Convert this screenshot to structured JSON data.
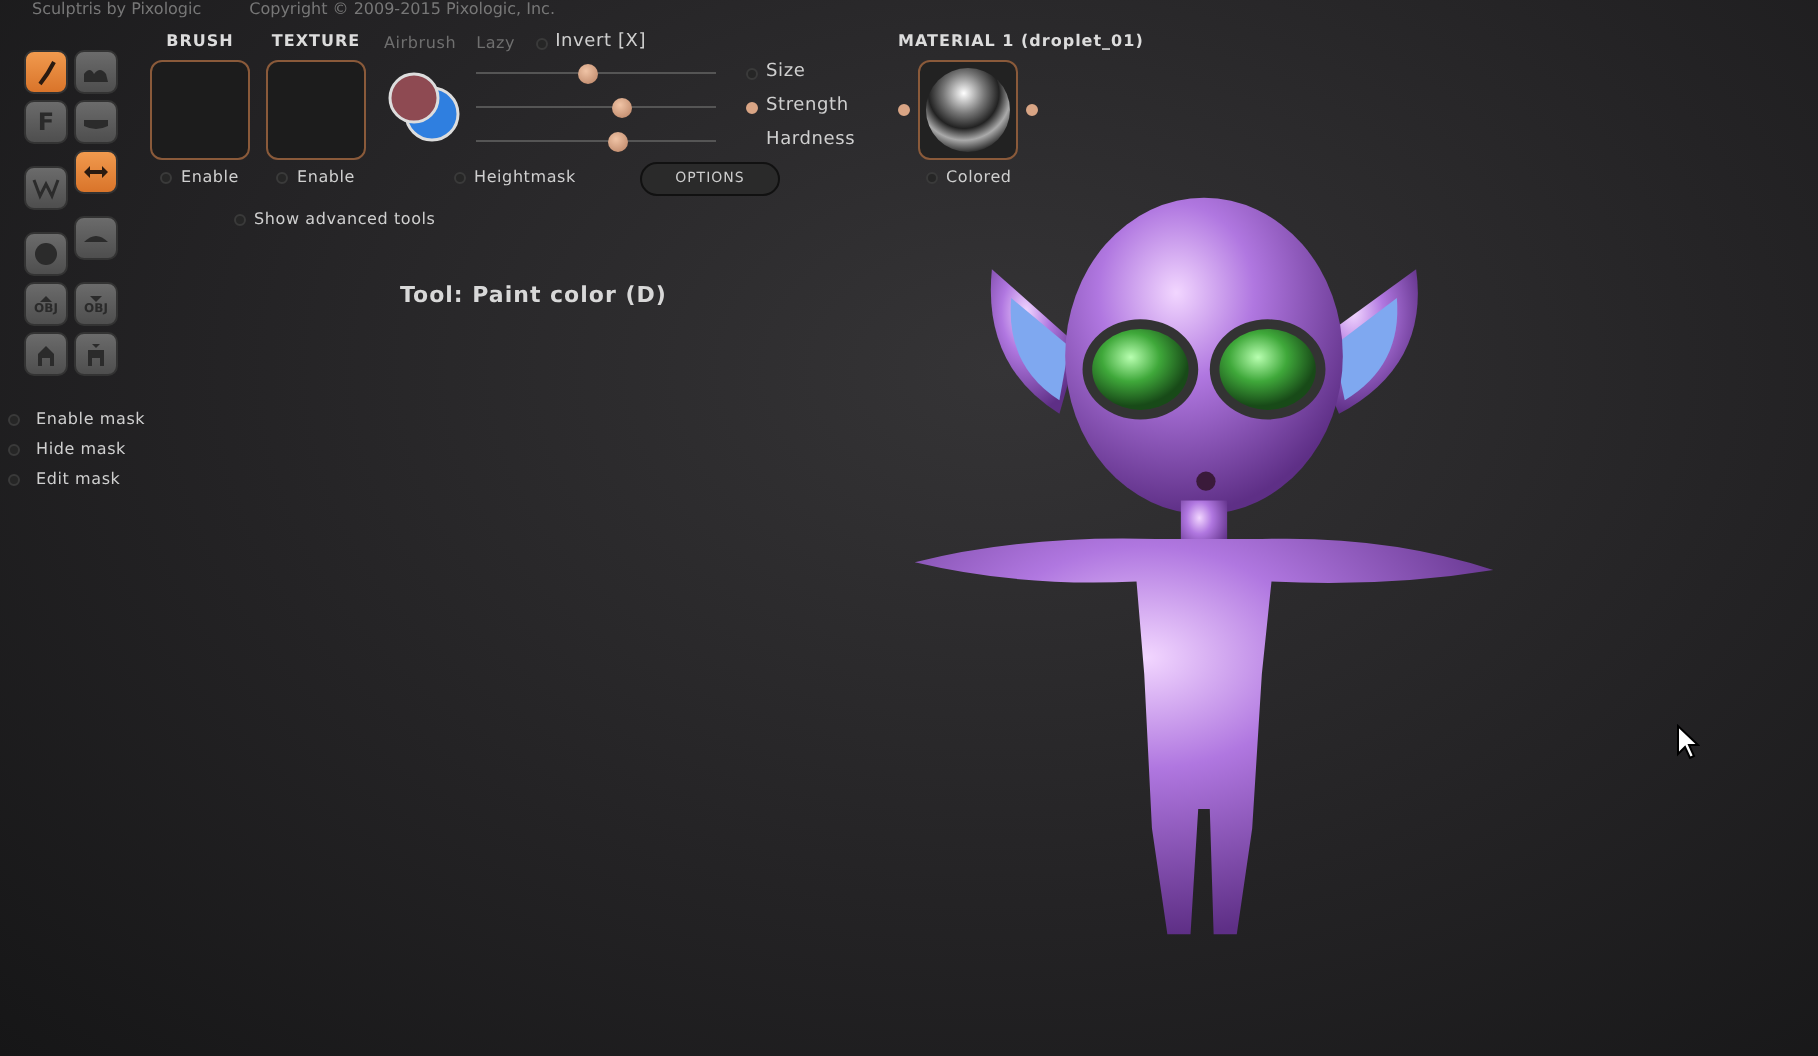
{
  "title_bar": {
    "app": "Sculptris by Pixologic",
    "copyright": "Copyright © 2009-2015 Pixologic, Inc."
  },
  "tools": [
    {
      "kind": "draw",
      "selected": true
    },
    {
      "kind": "crease",
      "selected": false
    },
    {
      "kind": "letter",
      "label": "F",
      "selected": false
    },
    {
      "kind": "flatten",
      "selected": false
    },
    {
      "kind": "zigzag",
      "selected": false
    },
    {
      "kind": "arrows",
      "selected": true
    },
    {
      "kind": "sphere",
      "selected": false
    },
    {
      "kind": "plane",
      "selected": false
    },
    {
      "kind": "obj-up",
      "label": "OBJ",
      "selected": false
    },
    {
      "kind": "obj-down",
      "label": "OBJ",
      "selected": false
    },
    {
      "kind": "figure-up",
      "selected": false
    },
    {
      "kind": "figure-down",
      "selected": false
    }
  ],
  "mask_options": [
    {
      "label": "Enable mask",
      "on": false
    },
    {
      "label": "Hide mask",
      "on": false
    },
    {
      "label": "Edit mask",
      "on": false
    }
  ],
  "brush": {
    "title": "BRUSH",
    "enable": {
      "label": "Enable",
      "on": false
    }
  },
  "texture": {
    "title": "TEXTURE",
    "enable": {
      "label": "Enable",
      "on": false
    }
  },
  "stroke_options": [
    {
      "label": "Airbrush",
      "on": false
    },
    {
      "label": "Lazy",
      "on": false
    }
  ],
  "invert": {
    "label": "Invert [X]",
    "on": false
  },
  "sliders": [
    {
      "label": "Size",
      "level": 0.47,
      "on": false
    },
    {
      "label": "Strength",
      "level": 0.61,
      "on": true
    },
    {
      "label": "Hardness",
      "level": 0.59
    }
  ],
  "heightmask": {
    "label": "Heightmask",
    "on": false
  },
  "options_button": "OPTIONS",
  "material": {
    "title": "MATERIAL 1 (droplet_01)",
    "colored": {
      "label": "Colored",
      "on": false
    }
  },
  "advanced": {
    "label": "Show advanced tools",
    "on": false
  },
  "tool_status": "Tool: Paint color (D)"
}
